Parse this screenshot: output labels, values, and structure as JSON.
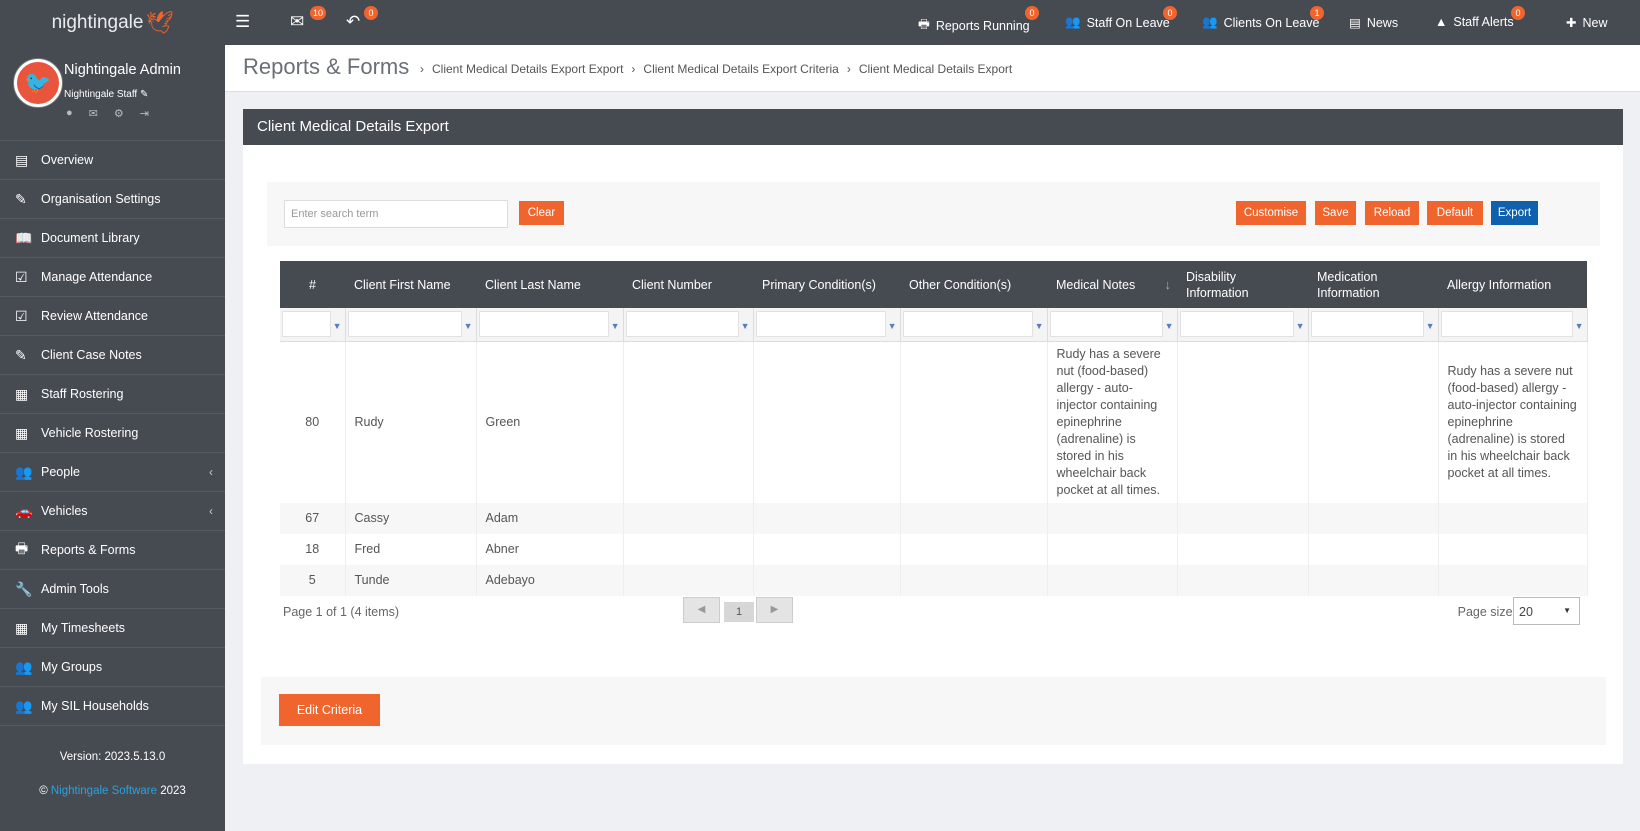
{
  "topbar": {
    "logo_text": "nightingale",
    "mail_badge": "10",
    "reply_badge": "0",
    "reports_running": {
      "label": "Reports Running",
      "badge": "0"
    },
    "staff_on_leave": {
      "label": "Staff On Leave",
      "badge": "0"
    },
    "clients_on_leave": {
      "label": "Clients On Leave",
      "badge": "1"
    },
    "news": {
      "label": "News"
    },
    "staff_alerts": {
      "label": "Staff Alerts",
      "badge": "0"
    },
    "new": {
      "label": "New"
    }
  },
  "profile": {
    "name": "Nightingale Admin",
    "role": "Nightingale Staff"
  },
  "sidebar": {
    "items": [
      {
        "label": "Overview",
        "icon": "list-icon"
      },
      {
        "label": "Organisation Settings",
        "icon": "edit-icon"
      },
      {
        "label": "Document Library",
        "icon": "book-icon"
      },
      {
        "label": "Manage Attendance",
        "icon": "calendar-check-icon"
      },
      {
        "label": "Review Attendance",
        "icon": "calendar-check-icon"
      },
      {
        "label": "Client Case Notes",
        "icon": "edit-icon"
      },
      {
        "label": "Staff Rostering",
        "icon": "calendar-icon"
      },
      {
        "label": "Vehicle Rostering",
        "icon": "calendar-icon"
      },
      {
        "label": "People",
        "icon": "users-icon"
      },
      {
        "label": "Vehicles",
        "icon": "car-icon"
      },
      {
        "label": "Reports & Forms",
        "icon": "print-icon"
      },
      {
        "label": "Admin Tools",
        "icon": "wrench-icon"
      },
      {
        "label": "My Timesheets",
        "icon": "calendar-icon"
      },
      {
        "label": "My Groups",
        "icon": "users-icon"
      },
      {
        "label": "My SIL Households",
        "icon": "users-icon"
      }
    ],
    "version": "Version: 2023.5.13.0",
    "copyright_prefix": "©",
    "copyright_link": "Nightingale Software",
    "copyright_year": "2023"
  },
  "header": {
    "title": "Reports & Forms",
    "breadcrumbs": [
      "Client Medical Details Export Export",
      "Client Medical Details Export Criteria",
      "Client Medical Details Export"
    ]
  },
  "panel": {
    "title": "Client Medical Details Export",
    "search_placeholder": "Enter search term",
    "clear_label": "Clear",
    "customise_label": "Customise",
    "save_label": "Save",
    "reload_label": "Reload",
    "default_label": "Default",
    "export_label": "Export",
    "edit_criteria_label": "Edit Criteria"
  },
  "table": {
    "columns": [
      "#",
      "Client First Name",
      "Client Last Name",
      "Client Number",
      "Primary Condition(s)",
      "Other Condition(s)",
      "Medical Notes",
      "Disability Information",
      "Medication Information",
      "Allergy Information"
    ],
    "sorted_column": "Medical Notes",
    "rows": [
      [
        "80",
        "Rudy",
        "Green",
        "",
        "",
        "",
        "Rudy has a severe nut (food-based) allergy - auto-injector containing epinephrine (adrenaline) is stored in his wheelchair back pocket at all times.",
        "",
        "",
        "Rudy has a severe nut (food-based) allergy - auto-injector containing epinephrine (adrenaline) is stored in his wheelchair back pocket at all times."
      ],
      [
        "67",
        "Cassy",
        "Adam",
        "",
        "",
        "",
        "",
        "",
        "",
        ""
      ],
      [
        "18",
        "Fred",
        "Abner",
        "",
        "",
        "",
        "",
        "",
        "",
        ""
      ],
      [
        "5",
        "Tunde",
        "Adebayo",
        "",
        "",
        "",
        "",
        "",
        "",
        ""
      ]
    ]
  },
  "pager": {
    "summary": "Page 1 of 1 (4 items)",
    "current_page": "1",
    "page_size_label": "Page size:",
    "page_size": "20"
  },
  "colors": {
    "topbar": "#464a51",
    "accent": "#f0642e",
    "export": "#0f61ad"
  }
}
